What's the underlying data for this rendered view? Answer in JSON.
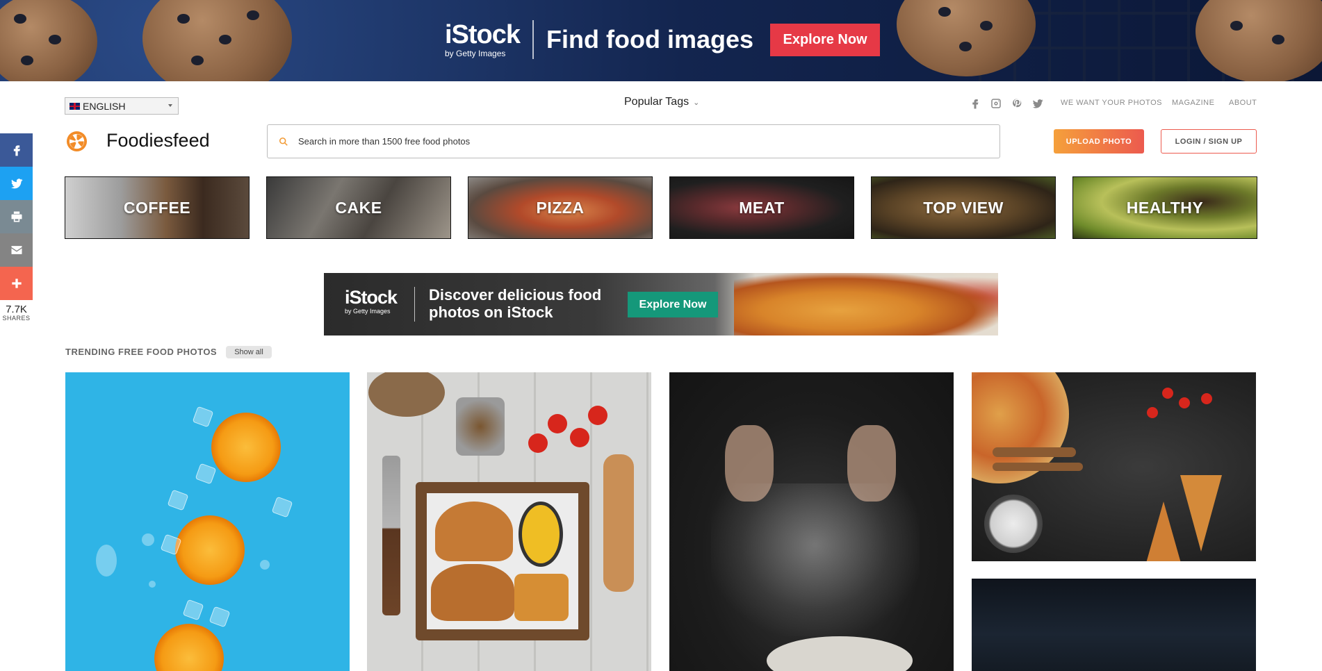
{
  "top_banner": {
    "brand": "iStock",
    "brand_sub": "by Getty Images",
    "headline": "Find food images",
    "cta": "Explore Now"
  },
  "header": {
    "language": "ENGLISH",
    "popular_tags": "Popular Tags",
    "nav": [
      "WE WANT YOUR PHOTOS",
      "MAGAZINE",
      "ABOUT"
    ],
    "social_icons": [
      "facebook-icon",
      "instagram-icon",
      "pinterest-icon",
      "twitter-icon"
    ],
    "brand_name": "Foodiesfeed",
    "search_placeholder": "Search in more than 1500 free food photos",
    "upload_label": "UPLOAD PHOTO",
    "login_label": "LOGIN / SIGN UP"
  },
  "share_bar": {
    "buttons": [
      {
        "icon": "facebook-icon",
        "color": "#3b5998"
      },
      {
        "icon": "twitter-icon",
        "color": "#1da1f2"
      },
      {
        "icon": "print-icon",
        "color": "#7a8a93"
      },
      {
        "icon": "email-icon",
        "color": "#848484"
      },
      {
        "icon": "plus-icon",
        "color": "#f4654f"
      }
    ],
    "count": "7.7K",
    "label": "SHARES"
  },
  "categories": [
    "COFFEE",
    "CAKE",
    "PIZZA",
    "MEAT",
    "TOP VIEW",
    "HEALTHY"
  ],
  "mid_ad": {
    "brand": "iStock",
    "brand_sub": "by Getty Images",
    "headline": "Discover delicious food photos on iStock",
    "cta": "Explore Now"
  },
  "trending": {
    "title": "TRENDING FREE FOOD PHOTOS",
    "show_all": "Show all"
  }
}
